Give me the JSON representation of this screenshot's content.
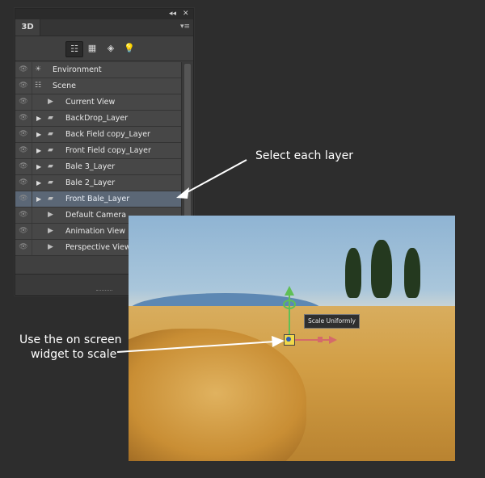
{
  "panel": {
    "tab_label": "3D",
    "titlebar": {
      "collapse_glyph": "◂◂",
      "close_glyph": "✕"
    },
    "menu_glyph": "▾≡",
    "toolbar": [
      {
        "name": "scene-filter",
        "glyph": "☷",
        "active": true
      },
      {
        "name": "mesh-filter",
        "glyph": "▦",
        "active": false
      },
      {
        "name": "materials-filter",
        "glyph": "◈",
        "active": false
      },
      {
        "name": "lights-filter",
        "glyph": "💡",
        "active": false
      }
    ],
    "layers": [
      {
        "label": "Environment",
        "indent": 0,
        "expand": false,
        "icon": "environment-icon",
        "glyph": "☀",
        "selected": false
      },
      {
        "label": "Scene",
        "indent": 0,
        "expand": false,
        "icon": "scene-icon",
        "glyph": "☷",
        "selected": false
      },
      {
        "label": "Current View",
        "indent": 1,
        "expand": false,
        "icon": "camera-icon",
        "glyph": "▶",
        "selected": false
      },
      {
        "label": "BackDrop_Layer",
        "indent": 1,
        "expand": true,
        "icon": "folder-icon",
        "glyph": "▰",
        "selected": false
      },
      {
        "label": "Back Field copy_Layer",
        "indent": 1,
        "expand": true,
        "icon": "folder-icon",
        "glyph": "▰",
        "selected": false
      },
      {
        "label": "Front Field copy_Layer",
        "indent": 1,
        "expand": true,
        "icon": "folder-icon",
        "glyph": "▰",
        "selected": false
      },
      {
        "label": "Bale 3_Layer",
        "indent": 1,
        "expand": true,
        "icon": "folder-icon",
        "glyph": "▰",
        "selected": false
      },
      {
        "label": "Bale 2_Layer",
        "indent": 1,
        "expand": true,
        "icon": "folder-icon",
        "glyph": "▰",
        "selected": false
      },
      {
        "label": "Front Bale_Layer",
        "indent": 1,
        "expand": true,
        "icon": "folder-icon",
        "glyph": "▰",
        "selected": true
      },
      {
        "label": "Default Camera",
        "indent": 1,
        "expand": false,
        "icon": "camera-icon",
        "glyph": "▶",
        "selected": false
      },
      {
        "label": "Animation View",
        "indent": 1,
        "expand": false,
        "icon": "camera-icon",
        "glyph": "▶",
        "selected": false
      },
      {
        "label": "Perspective View",
        "indent": 1,
        "expand": false,
        "icon": "camera-icon",
        "glyph": "▶",
        "selected": false
      }
    ],
    "footer": {
      "new_glyph": "▣",
      "delete_glyph": "🗑"
    }
  },
  "viewport": {
    "tooltip": "Scale Uniformly"
  },
  "annotations": {
    "select_layer": "Select each layer",
    "widget_line1": "Use the on screen",
    "widget_line2": "widget to scale"
  },
  "colors": {
    "selected_row": "#5b6776",
    "widget_y": "#5fbf55",
    "widget_x": "#d46a6a",
    "widget_center": "#f1d84a"
  }
}
